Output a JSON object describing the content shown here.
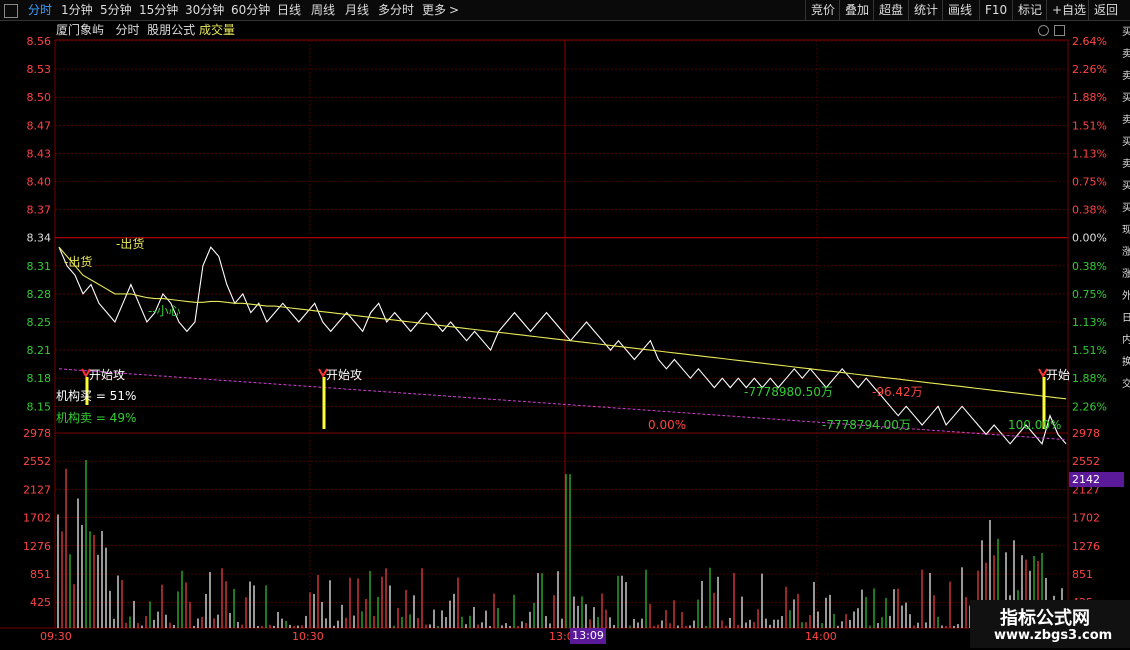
{
  "toolbar": {
    "tabs": [
      "分时",
      "1分钟",
      "5分钟",
      "15分钟",
      "30分钟",
      "60分钟",
      "日线",
      "周线",
      "月线",
      "多分时",
      "更多"
    ],
    "more_glyph": ">",
    "right_buttons": [
      "竞价",
      "叠加",
      "超盘",
      "统计",
      "画线",
      "F10",
      "标记",
      "+自选",
      "返回"
    ]
  },
  "header": {
    "stock_name": "厦门象屿",
    "period": "分时",
    "formula": "股朋公式",
    "indicator": "成交量"
  },
  "colors": {
    "price_up": "#ff4444",
    "price_down": "#33cc33",
    "price_line": "#ffffff",
    "avg_line": "#e8e85a",
    "pink_line": "#d040d0",
    "grid": "#7a0000",
    "vol_badge": "#5a1a9a"
  },
  "price_axis": {
    "left": [
      "8.56",
      "8.53",
      "8.50",
      "8.47",
      "8.43",
      "8.40",
      "8.37",
      "8.34",
      "8.31",
      "8.28",
      "8.25",
      "8.21",
      "8.18",
      "8.15"
    ],
    "right": [
      "2.64%",
      "2.26%",
      "1.88%",
      "1.51%",
      "1.13%",
      "0.75%",
      "0.38%",
      "0.00%",
      "0.38%",
      "0.75%",
      "1.13%",
      "1.51%",
      "1.88%",
      "2.26%"
    ]
  },
  "volume_axis": [
    "2978",
    "2552",
    "2127",
    "1702",
    "1276",
    "851",
    "425"
  ],
  "time_axis": [
    "09:30",
    "10:30",
    "13:00",
    "14:00"
  ],
  "cursor": {
    "time": "13:09",
    "volume": "2142"
  },
  "annotations": {
    "sell1": "-出货",
    "sell2": "-出货",
    "careful": "--小心",
    "attack1": "开始攻",
    "attack2": "开始攻",
    "attack3": "开始",
    "inst_buy": "机构买 = 51%",
    "inst_sell": "机构卖 = 49%",
    "pct0": "0.00%",
    "flow1": "-7778980.50万",
    "flow2": "-7778794.00万",
    "flow3": "-96.42万",
    "pct100": "100.00%"
  },
  "side_strip": "买卖卖买卖买卖买买现涨涨外日内换交",
  "watermark": {
    "line1": "指标公式网",
    "line2": "www.zbgs3.com"
  },
  "chart_data": {
    "type": "line",
    "prev_close": 8.34,
    "price": [
      8.34,
      8.32,
      8.31,
      8.29,
      8.3,
      8.28,
      8.27,
      8.26,
      8.28,
      8.3,
      8.28,
      8.26,
      8.27,
      8.29,
      8.28,
      8.26,
      8.25,
      8.26,
      8.32,
      8.34,
      8.33,
      8.3,
      8.28,
      8.29,
      8.27,
      8.28,
      8.26,
      8.27,
      8.28,
      8.27,
      8.26,
      8.27,
      8.28,
      8.26,
      8.25,
      8.26,
      8.27,
      8.26,
      8.25,
      8.27,
      8.28,
      8.26,
      8.27,
      8.26,
      8.25,
      8.26,
      8.27,
      8.26,
      8.25,
      8.26,
      8.25,
      8.24,
      8.25,
      8.24,
      8.23,
      8.25,
      8.26,
      8.27,
      8.26,
      8.25,
      8.26,
      8.27,
      8.26,
      8.25,
      8.24,
      8.25,
      8.26,
      8.25,
      8.24,
      8.23,
      8.24,
      8.23,
      8.22,
      8.23,
      8.24,
      8.22,
      8.21,
      8.22,
      8.21,
      8.2,
      8.21,
      8.2,
      8.19,
      8.2,
      8.19,
      8.2,
      8.19,
      8.2,
      8.19,
      8.2,
      8.19,
      8.2,
      8.21,
      8.2,
      8.21,
      8.2,
      8.19,
      8.2,
      8.21,
      8.2,
      8.19,
      8.2,
      8.19,
      8.18,
      8.17,
      8.16,
      8.17,
      8.16,
      8.15,
      8.16,
      8.17,
      8.15,
      8.16,
      8.17,
      8.16,
      8.15,
      8.14,
      8.15,
      8.14,
      8.13,
      8.14,
      8.15,
      8.14,
      8.13,
      8.16,
      8.14,
      8.13
    ],
    "avg": [
      8.34,
      8.33,
      8.32,
      8.31,
      8.305,
      8.3,
      8.295,
      8.29,
      8.29,
      8.29,
      8.288,
      8.286,
      8.285,
      8.285,
      8.284,
      8.283,
      8.282,
      8.281,
      8.281,
      8.282,
      8.282,
      8.281,
      8.28,
      8.28,
      8.279,
      8.278,
      8.277,
      8.277,
      8.276,
      8.275,
      8.274,
      8.273,
      8.272,
      8.271,
      8.27,
      8.269,
      8.268,
      8.267,
      8.266,
      8.265,
      8.264,
      8.263,
      8.262,
      8.261,
      8.26,
      8.259,
      8.258,
      8.257,
      8.256,
      8.255,
      8.254,
      8.253,
      8.252,
      8.251,
      8.25,
      8.249,
      8.248,
      8.247,
      8.246,
      8.245,
      8.244,
      8.243,
      8.242,
      8.241,
      8.24,
      8.239,
      8.238,
      8.237,
      8.236,
      8.235,
      8.234,
      8.233,
      8.232,
      8.231,
      8.23,
      8.229,
      8.228,
      8.227,
      8.226,
      8.225,
      8.224,
      8.223,
      8.222,
      8.221,
      8.22,
      8.219,
      8.218,
      8.217,
      8.216,
      8.215,
      8.214,
      8.213,
      8.212,
      8.211,
      8.21,
      8.209,
      8.208,
      8.207,
      8.206,
      8.205,
      8.204,
      8.203,
      8.202,
      8.201,
      8.2,
      8.199,
      8.198,
      8.197,
      8.196,
      8.195,
      8.194,
      8.193,
      8.192,
      8.191,
      8.19,
      8.189,
      8.188,
      8.187,
      8.186,
      8.185,
      8.184,
      8.183,
      8.182,
      8.181,
      8.18,
      8.179,
      8.178
    ],
    "volume_ylim": [
      0,
      2978
    ],
    "price_ylim": [
      8.13,
      8.57
    ]
  }
}
